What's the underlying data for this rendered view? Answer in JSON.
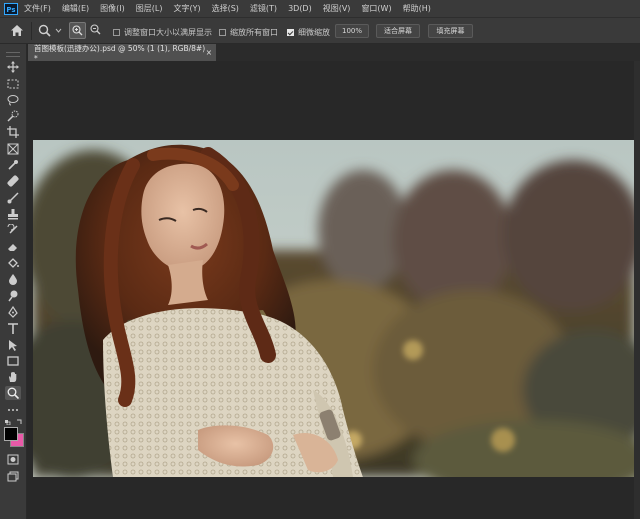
{
  "app": {
    "logo": "Ps"
  },
  "menu": [
    "文件(F)",
    "编辑(E)",
    "图像(I)",
    "图层(L)",
    "文字(Y)",
    "选择(S)",
    "滤镜(T)",
    "3D(D)",
    "视图(V)",
    "窗口(W)",
    "帮助(H)"
  ],
  "options": {
    "resize_windows_label": "调整窗口大小以满屏显示",
    "zoom_all_windows_label": "缩放所有窗口",
    "scrubby_zoom_label": "细微缩放",
    "zoom_value": "100%",
    "fit_screen_label": "适合屏幕",
    "fill_screen_label": "填充屏幕",
    "resize_windows_checked": false,
    "zoom_all_windows_checked": false,
    "scrubby_zoom_checked": true
  },
  "document": {
    "tab_title": "首图模板(迅捷办公).psd @ 50% (1 (1), RGB/8#) *",
    "close_glyph": "×"
  },
  "tools": [
    "move-icon",
    "marquee-icon",
    "lasso-icon",
    "quick-select-icon",
    "crop-icon",
    "frame-icon",
    "eyedropper-icon",
    "healing-icon",
    "brush-icon",
    "stamp-icon",
    "history-brush-icon",
    "eraser-icon",
    "paint-bucket-icon",
    "blur-icon",
    "dodge-icon",
    "pen-icon",
    "type-icon",
    "path-select-icon",
    "rectangle-icon",
    "hand-icon",
    "zoom-icon",
    "more-icon"
  ],
  "colors": {
    "foreground": "#000000",
    "background": "#e85aa8",
    "accent": "#31a8ff"
  }
}
